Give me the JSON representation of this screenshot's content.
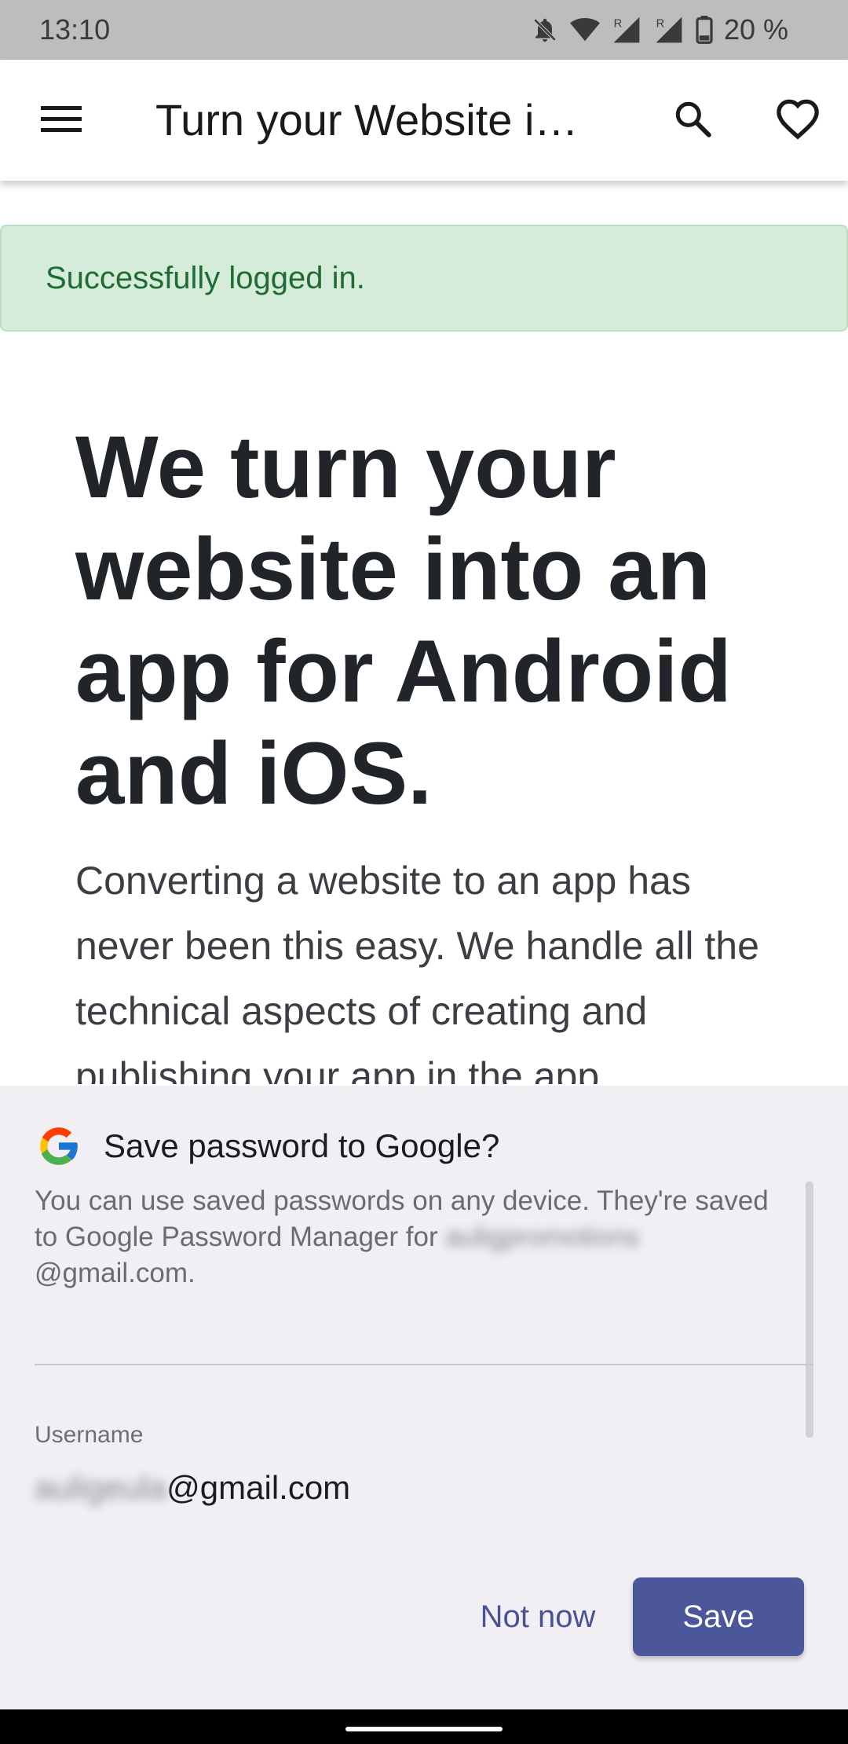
{
  "status_bar": {
    "time": "13:10",
    "battery": "20 %",
    "icons": [
      "notifications-off-icon",
      "wifi-icon",
      "signal-r-icon",
      "signal-r-icon",
      "battery-icon"
    ]
  },
  "app_bar": {
    "title": "Turn your Website i…",
    "icons": [
      "menu-icon",
      "search-icon",
      "heart-icon"
    ]
  },
  "alert": {
    "message": "Successfully logged in.",
    "colors": {
      "background": "#d4ecd9",
      "text": "#1f6b31"
    }
  },
  "hero": {
    "title": "We turn your website into an app for Android and iOS.",
    "description": "Converting a website to an app has never been this easy. We handle all the technical aspects of creating and publishing your app in the app"
  },
  "save_password_sheet": {
    "title": "Save password to Google?",
    "description_prefix": "You can use saved passwords on any device. They're saved to Google Password Manager for ",
    "description_email_blurred": "auligpromotions",
    "description_email_suffix": "@gmail.com.",
    "username_label": "Username",
    "username_blurred": "auligeula",
    "username_suffix": "@gmail.com",
    "not_now_label": "Not now",
    "save_label": "Save",
    "accent_color": "#4b579a"
  }
}
